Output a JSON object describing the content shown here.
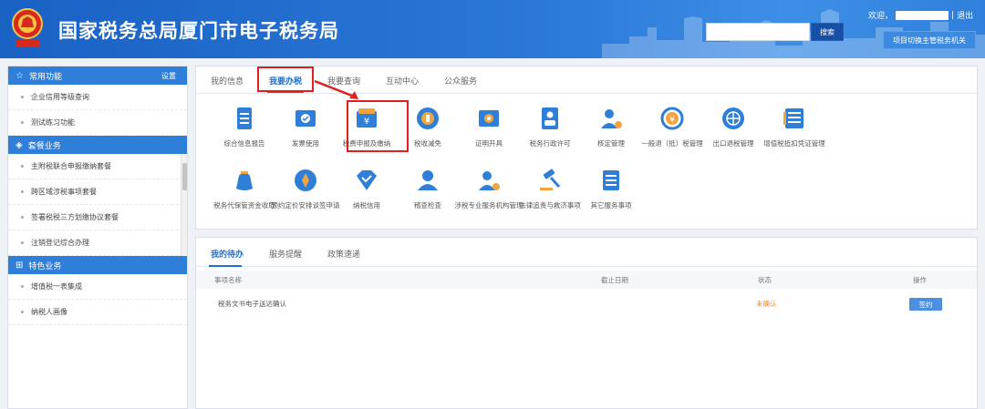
{
  "header": {
    "site_title": "国家税务总局厦门市电子税务局",
    "emblem_caption": "中国税务",
    "search_placeholder": "",
    "search_btn": "搜索",
    "welcome_label": "欢迎，",
    "separator": "|",
    "logout": "退出",
    "switch_btn": "项目切换主管税务机关",
    "brand_color": "#1a61c4"
  },
  "sidebar": {
    "section_common": {
      "title": "常用功能",
      "right": "设置"
    },
    "common_items": [
      "企业信用等级查询",
      "测试练习功能"
    ],
    "section_package": {
      "title": "套餐业务"
    },
    "package_items": [
      "主附税联合申报缴纳套餐",
      "跨区域涉税事项套餐",
      "签署税税三方划缴协议套餐",
      "注销登记综合办理"
    ],
    "section_special": {
      "title": "特色业务"
    },
    "special_items": [
      "增值税一表集成",
      "纳税人画像"
    ]
  },
  "main": {
    "tabs": [
      "我的信息",
      "我要办税",
      "我要查询",
      "互动中心",
      "公众服务"
    ],
    "active_tab": "我要办税",
    "icons_row1": [
      {
        "label": "综合信息报告",
        "icon": "report-icon"
      },
      {
        "label": "发票使用",
        "icon": "invoice-icon"
      },
      {
        "label": "税费申报及缴纳",
        "icon": "tax-declare-icon"
      },
      {
        "label": "税收减免",
        "icon": "tax-relief-icon"
      },
      {
        "label": "证明开具",
        "icon": "certificate-icon"
      },
      {
        "label": "税务行政许可",
        "icon": "license-icon"
      },
      {
        "label": "核定管理",
        "icon": "verify-icon"
      },
      {
        "label": "一般退（抵）税管理",
        "icon": "refund-icon"
      },
      {
        "label": "出口退税管理",
        "icon": "export-refund-icon"
      },
      {
        "label": "增值税抵扣凭证管理",
        "icon": "vat-deduct-icon"
      }
    ],
    "icons_row2": [
      {
        "label": "税务代保管资金收取",
        "icon": "custody-fund-icon"
      },
      {
        "label": "预约定价安排谈签申请",
        "icon": "pricing-icon"
      },
      {
        "label": "纳税信用",
        "icon": "credit-icon"
      },
      {
        "label": "稽查检查",
        "icon": "inspection-icon"
      },
      {
        "label": "涉税专业服务机构管理",
        "icon": "agency-icon"
      },
      {
        "label": "法律追责与救济事项",
        "icon": "law-icon"
      },
      {
        "label": "其它服务事项",
        "icon": "other-service-icon"
      }
    ]
  },
  "todo": {
    "tabs": [
      "我的待办",
      "服务提醒",
      "政策速递"
    ],
    "columns": [
      "事项名称",
      "截止日期",
      "状态",
      "操作"
    ],
    "rows": [
      {
        "name": "税务文书电子送达确认",
        "deadline": "",
        "status": "未确认",
        "action": "签约"
      }
    ]
  }
}
